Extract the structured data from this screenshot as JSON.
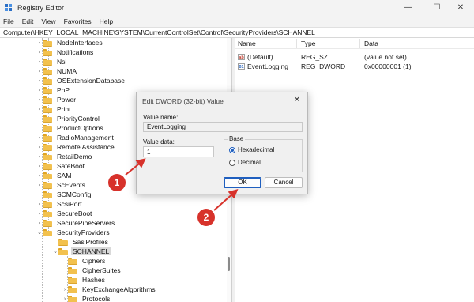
{
  "window": {
    "title": "Registry Editor"
  },
  "menu": [
    "File",
    "Edit",
    "View",
    "Favorites",
    "Help"
  ],
  "address": "Computer\\HKEY_LOCAL_MACHINE\\SYSTEM\\CurrentControlSet\\Control\\SecurityProviders\\SCHANNEL",
  "tree": {
    "items": [
      {
        "label": "NodeInterfaces",
        "depth": 0,
        "chevron": "›"
      },
      {
        "label": "Notifications",
        "depth": 0,
        "chevron": "›"
      },
      {
        "label": "Nsi",
        "depth": 0,
        "chevron": "›"
      },
      {
        "label": "NUMA",
        "depth": 0,
        "chevron": "›"
      },
      {
        "label": "OSExtensionDatabase",
        "depth": 0,
        "chevron": "›"
      },
      {
        "label": "PnP",
        "depth": 0,
        "chevron": "›"
      },
      {
        "label": "Power",
        "depth": 0,
        "chevron": "›"
      },
      {
        "label": "Print",
        "depth": 0,
        "chevron": "›"
      },
      {
        "label": "PriorityControl",
        "depth": 0,
        "chevron": ""
      },
      {
        "label": "ProductOptions",
        "depth": 0,
        "chevron": ""
      },
      {
        "label": "RadioManagement",
        "depth": 0,
        "chevron": "›"
      },
      {
        "label": "Remote Assistance",
        "depth": 0,
        "chevron": "›"
      },
      {
        "label": "RetailDemo",
        "depth": 0,
        "chevron": "›"
      },
      {
        "label": "SafeBoot",
        "depth": 0,
        "chevron": "›"
      },
      {
        "label": "SAM",
        "depth": 0,
        "chevron": "›"
      },
      {
        "label": "ScEvents",
        "depth": 0,
        "chevron": "›"
      },
      {
        "label": "SCMConfig",
        "depth": 0,
        "chevron": ""
      },
      {
        "label": "ScsiPort",
        "depth": 0,
        "chevron": "›"
      },
      {
        "label": "SecureBoot",
        "depth": 0,
        "chevron": "›"
      },
      {
        "label": "SecurePipeServers",
        "depth": 0,
        "chevron": "›"
      },
      {
        "label": "SecurityProviders",
        "depth": 0,
        "chevron": "⌄"
      },
      {
        "label": "SaslProfiles",
        "depth": 1,
        "chevron": ""
      },
      {
        "label": "SCHANNEL",
        "depth": 1,
        "chevron": "⌄",
        "selected": true
      },
      {
        "label": "Ciphers",
        "depth": 2,
        "chevron": ""
      },
      {
        "label": "CipherSuites",
        "depth": 2,
        "chevron": ""
      },
      {
        "label": "Hashes",
        "depth": 2,
        "chevron": ""
      },
      {
        "label": "KeyExchangeAlgorithms",
        "depth": 2,
        "chevron": "›"
      },
      {
        "label": "Protocols",
        "depth": 2,
        "chevron": "›"
      }
    ]
  },
  "list": {
    "headers": {
      "name": "Name",
      "type": "Type",
      "data": "Data"
    },
    "rows": [
      {
        "icon": "ab",
        "name": "(Default)",
        "type": "REG_SZ",
        "data": "(value not set)"
      },
      {
        "icon": "01",
        "name": "EventLogging",
        "type": "REG_DWORD",
        "data": "0x00000001 (1)"
      }
    ]
  },
  "dialog": {
    "title": "Edit DWORD (32-bit) Value",
    "close_glyph": "✕",
    "value_name_label": "Value name:",
    "value_name": "EventLogging",
    "value_data_label": "Value data:",
    "value_data": "1",
    "base_label": "Base",
    "hex_label": "Hexadecimal",
    "dec_label": "Decimal",
    "base_selected": "Hexadecimal",
    "ok_label": "OK",
    "cancel_label": "Cancel"
  },
  "annotations": [
    {
      "number": "1"
    },
    {
      "number": "2"
    }
  ],
  "colors": {
    "accent": "#1f5fbf",
    "annotation": "#d7322b",
    "folder": "#f2c14e"
  },
  "icons": [
    "registry-editor-icon",
    "minimize-icon",
    "maximize-icon",
    "close-icon",
    "folder-icon",
    "chevron-right-icon",
    "chevron-down-icon",
    "string-value-icon",
    "dword-value-icon"
  ]
}
